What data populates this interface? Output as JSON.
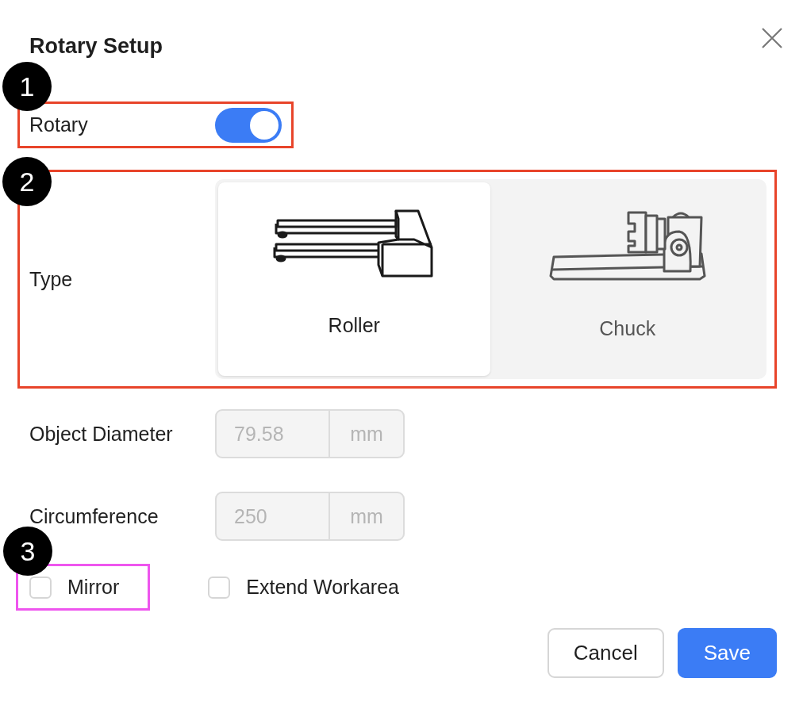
{
  "dialog": {
    "title": "Rotary Setup"
  },
  "rotary": {
    "label": "Rotary",
    "on": true,
    "annotation": {
      "label": "1",
      "color": "#e8442a"
    }
  },
  "type": {
    "label": "Type",
    "annotation": {
      "label": "2",
      "color": "#e8442a"
    },
    "options": [
      {
        "label": "Roller",
        "kind": "roller",
        "selected": true
      },
      {
        "label": "Chuck",
        "kind": "chuck",
        "selected": false
      }
    ]
  },
  "fields": [
    {
      "label": "Object Diameter",
      "value": "79.58",
      "unit": "mm",
      "disabled": true
    },
    {
      "label": "Circumference",
      "value": "250",
      "unit": "mm",
      "disabled": true
    }
  ],
  "checkboxes": [
    {
      "label": "Mirror",
      "checked": false,
      "annotation": {
        "label": "3",
        "color": "#ee55ee"
      }
    },
    {
      "label": "Extend Workarea",
      "checked": false
    }
  ],
  "buttons": [
    {
      "label": "Cancel",
      "kind": "secondary"
    },
    {
      "label": "Save",
      "kind": "primary"
    }
  ]
}
